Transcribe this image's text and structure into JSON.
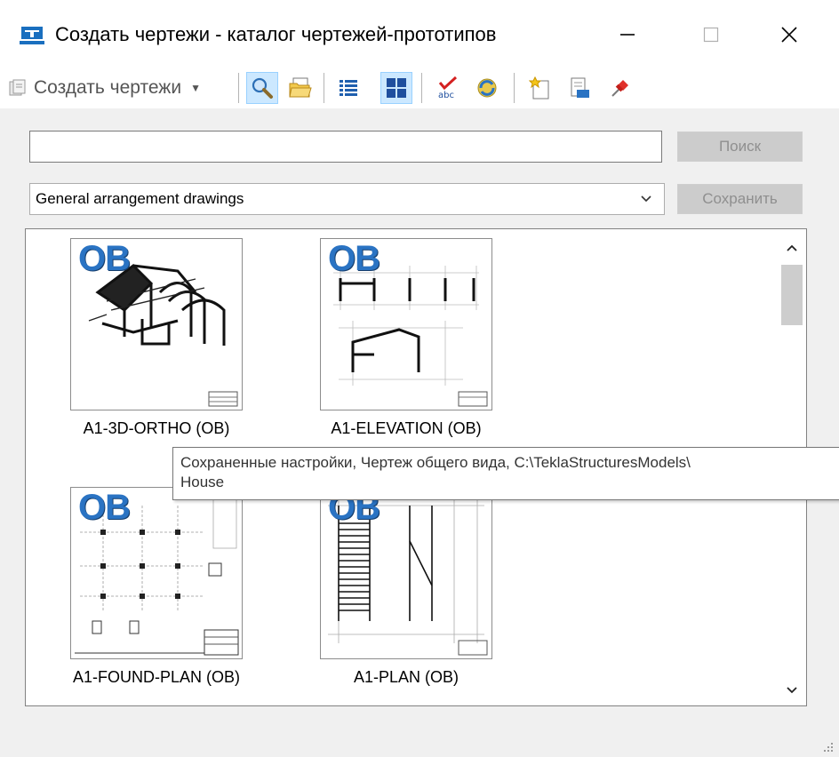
{
  "window": {
    "title": "Создать чертежи - каталог чертежей-прототипов",
    "app_icon": "tekla-drawing-icon",
    "controls": [
      "minimize-icon",
      "maximize-icon",
      "close-icon"
    ]
  },
  "toolbar": {
    "create_label": "Создать чертежи",
    "buttons": [
      {
        "icon": "search-icon",
        "active": true
      },
      {
        "icon": "folder-icon",
        "active": false
      },
      {
        "icon": "list-view-icon",
        "active": false
      },
      {
        "icon": "thumbnail-view-icon",
        "active": true
      },
      {
        "icon": "spellcheck-icon",
        "active": false
      },
      {
        "icon": "refresh-icon",
        "active": false
      },
      {
        "icon": "new-document-icon",
        "active": false
      },
      {
        "icon": "export-icon",
        "active": false
      },
      {
        "icon": "pin-icon",
        "active": false
      }
    ]
  },
  "search": {
    "value": "",
    "button_label": "Поиск"
  },
  "filter": {
    "selected": "General arrangement drawings",
    "save_label": "Сохранить"
  },
  "gallery": {
    "items": [
      {
        "caption": "A1-3D-ORTHO (OB)",
        "badge": "OB"
      },
      {
        "caption": "A1-ELEVATION (OB)",
        "badge": "OB"
      },
      {
        "caption": "A1-FOUND-PLAN (OB)",
        "badge": "OB"
      },
      {
        "caption": "A1-PLAN (OB)",
        "badge": "OB"
      }
    ]
  },
  "tooltip": {
    "line1": "Сохраненные настройки, Чертеж общего вида, C:\\TeklaStructuresModels\\",
    "line2": "House"
  },
  "colors": {
    "accent": "#2a73c3",
    "active_button_bg": "#cce8ff",
    "disabled_button_bg": "#cccccc"
  }
}
